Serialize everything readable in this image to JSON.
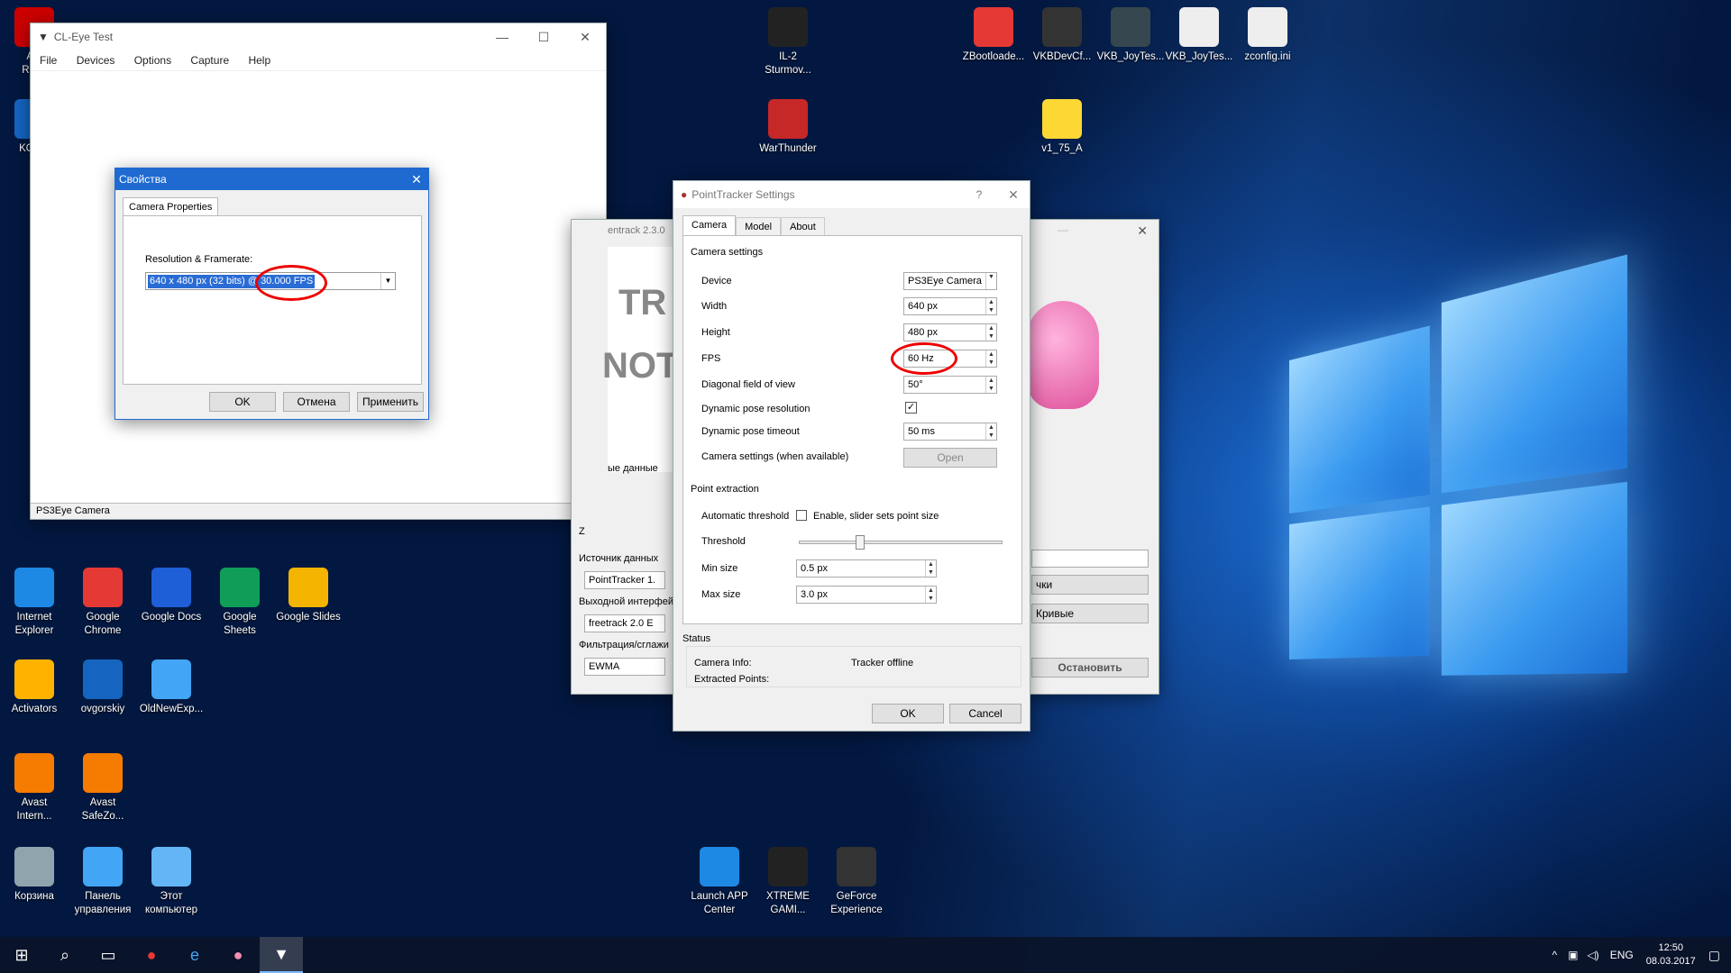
{
  "desktop_icons": [
    {
      "label": "Acr\nRead",
      "icon": "pdf-icon",
      "color": "#c00"
    },
    {
      "label": "KOMP\nV",
      "icon": "app-icon",
      "color": "#1565c0"
    },
    {
      "label": "Internet\nExplorer",
      "icon": "ie-icon",
      "color": "#1e88e5"
    },
    {
      "label": "Google\nChrome",
      "icon": "chrome-icon",
      "color": "#e53935"
    },
    {
      "label": "Google Docs",
      "icon": "docs-icon",
      "color": "#1e5ed6"
    },
    {
      "label": "Google\nSheets",
      "icon": "sheets-icon",
      "color": "#0f9d58"
    },
    {
      "label": "Google Slides",
      "icon": "slides-icon",
      "color": "#f4b400"
    },
    {
      "label": "Activators",
      "icon": "key-icon",
      "color": "#ffb300"
    },
    {
      "label": "ovgorskiy",
      "icon": "user-icon",
      "color": "#1565c0"
    },
    {
      "label": "OldNewExp...",
      "icon": "shield-icon",
      "color": "#42a5f5"
    },
    {
      "label": "Avast\nIntern...",
      "icon": "avast-icon",
      "color": "#f57c00"
    },
    {
      "label": "Avast\nSafeZo...",
      "icon": "avast-safezone-icon",
      "color": "#f57c00"
    },
    {
      "label": "Корзина",
      "icon": "recycle-bin-icon",
      "color": "#90a4ae"
    },
    {
      "label": "Панель\nуправления",
      "icon": "control-panel-icon",
      "color": "#42a5f5"
    },
    {
      "label": "Этот\nкомпьютер",
      "icon": "computer-icon",
      "color": "#64b5f6"
    },
    {
      "label": "IL-2\nSturmov...",
      "icon": "il2-icon",
      "color": "#222"
    },
    {
      "label": "WarThunder",
      "icon": "warthunder-icon",
      "color": "#c62828"
    },
    {
      "label": "ZBootloade...",
      "icon": "zboot-icon",
      "color": "#e53935"
    },
    {
      "label": "VKBDevCf...",
      "icon": "joystick-icon",
      "color": "#333"
    },
    {
      "label": "VKB_JoyTes...",
      "icon": "vkb-icon",
      "color": "#37474f"
    },
    {
      "label": "VKB_JoyTes...",
      "icon": "gear-file-icon",
      "color": "#eee"
    },
    {
      "label": "zconfig.ini",
      "icon": "gear-file-icon",
      "color": "#eee"
    },
    {
      "label": "v1_75_A",
      "icon": "folder-icon",
      "color": "#fdd835"
    },
    {
      "label": "Launch APP\nCenter",
      "icon": "app-center-icon",
      "color": "#1e88e5"
    },
    {
      "label": "XTREME\nGAMI...",
      "icon": "xtreme-icon",
      "color": "#222"
    },
    {
      "label": "GeForce\nExperience",
      "icon": "geforce-icon",
      "color": "#333"
    }
  ],
  "cleye": {
    "title": "CL-Eye Test",
    "menu": [
      "File",
      "Devices",
      "Options",
      "Capture",
      "Help"
    ],
    "status": "PS3Eye Camera"
  },
  "props": {
    "title": "Свойства",
    "tab": "Camera Properties",
    "res_label": "Resolution & Framerate:",
    "res_value": "640 x 480 px (32 bits) @ 30.000 FPS",
    "ok": "OK",
    "cancel": "Отмена",
    "apply": "Применить"
  },
  "opentrack": {
    "title_partial": "entrack 2.3.0",
    "big1": "TR",
    "big2": "NOT",
    "data_label": "ые данные",
    "z_label": "Z",
    "source_label": "Источник данных",
    "source_value": "PointTracker 1.",
    "output_label": "Выходной интерфей",
    "output_value": "freetrack 2.0 E",
    "filter_label": "Фильтрация/сглажи",
    "filter_value": "EWMA",
    "keys_btn": "чки",
    "curves_btn": "Кривые",
    "stop_btn": "Остановить"
  },
  "pt": {
    "title": "PointTracker Settings",
    "help": "?",
    "tabs": [
      "Camera",
      "Model",
      "About"
    ],
    "camera_settings": "Camera settings",
    "rows": [
      {
        "label": "Device",
        "value": "PS3Eye Camera"
      },
      {
        "label": "Width",
        "value": "640 px"
      },
      {
        "label": "Height",
        "value": "480 px"
      },
      {
        "label": "FPS",
        "value": "60 Hz"
      },
      {
        "label": "Diagonal field of view",
        "value": "50°"
      },
      {
        "label": "Dynamic pose resolution",
        "value": "✓"
      },
      {
        "label": "Dynamic pose timeout",
        "value": "50 ms"
      },
      {
        "label": "Camera settings (when available)",
        "value": "Open"
      }
    ],
    "point_extraction": "Point extraction",
    "auto_thresh": "Automatic threshold",
    "auto_thresh_cb": "Enable, slider sets point size",
    "threshold": "Threshold",
    "min_size": "Min size",
    "min_value": "0.5 px",
    "max_size": "Max size",
    "max_value": "3.0 px",
    "status": "Status",
    "cam_info": "Camera Info:",
    "cam_info_value": "Tracker offline",
    "extracted": "Extracted Points:",
    "ok": "OK",
    "cancel": "Cancel"
  },
  "taskbar": {
    "lang": "ENG",
    "time": "12:50",
    "date": "08.03.2017"
  }
}
